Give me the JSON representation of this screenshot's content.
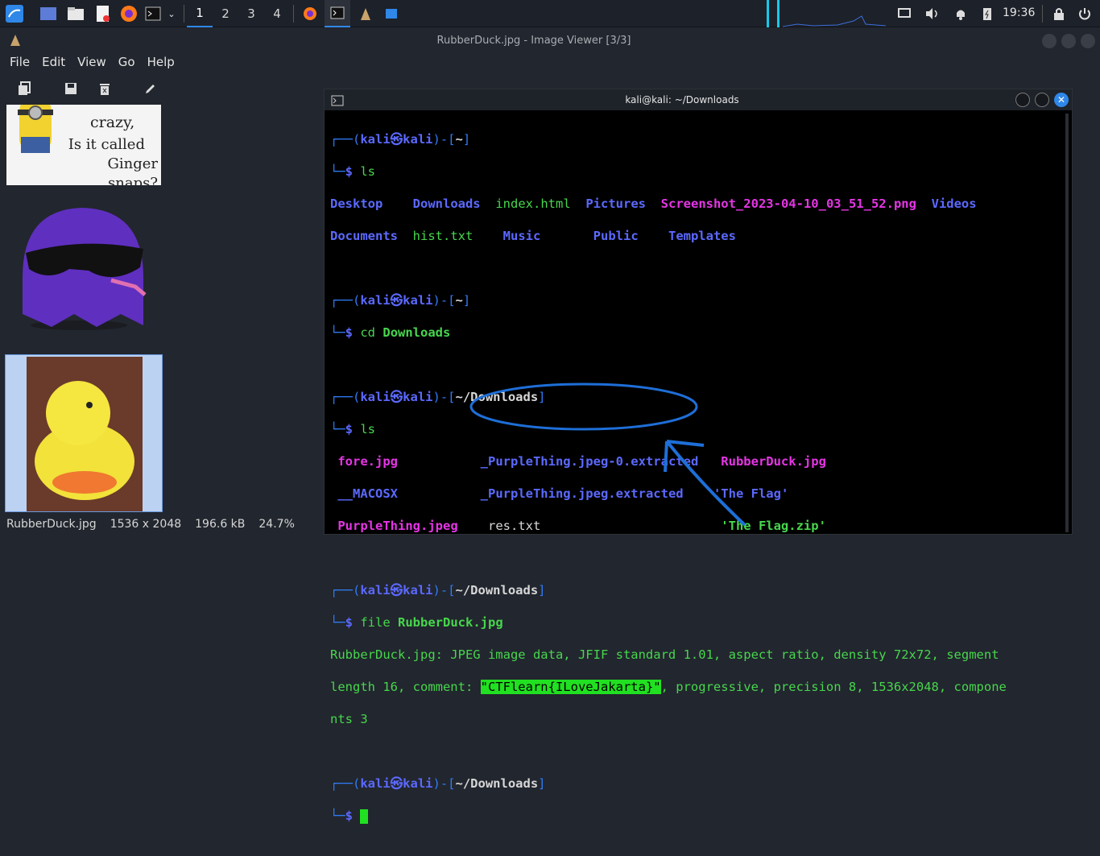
{
  "taskbar": {
    "workspaces": [
      "1",
      "2",
      "3",
      "4"
    ],
    "clock": "19:36"
  },
  "viewer": {
    "title": "RubberDuck.jpg - Image Viewer [3/3]",
    "menus": [
      "File",
      "Edit",
      "View",
      "Go",
      "Help"
    ],
    "thumb1_text": [
      "crazy,",
      "Is it called",
      "Ginger snaps?"
    ],
    "status": {
      "filename": "RubberDuck.jpg",
      "dimensions": "1536 x 2048",
      "size": "196.6 kB",
      "zoom": "24.7%"
    }
  },
  "terminal": {
    "title": "kali@kali: ~/Downloads",
    "prompt_user": "kali",
    "prompt_host": "kali",
    "cmd1": "ls",
    "cmd2": "cd",
    "cmd2_arg": "Downloads",
    "cmd3": "ls",
    "cmd4": "file",
    "cmd4_arg": "RubberDuck.jpg",
    "ls1": [
      "Desktop",
      "Downloads",
      "index.html",
      "Pictures",
      "Screenshot_2023-04-10_03_51_52.png",
      "Videos",
      "Documents",
      "hist.txt",
      "Music",
      "Public",
      "Templates"
    ],
    "ls2": [
      "fore.jpg",
      "_PurpleThing.jpeg-0.extracted",
      "RubberDuck.jpg",
      "__MACOSX",
      "_PurpleThing.jpeg.extracted",
      "'The Flag'",
      "PurpleThing.jpeg",
      "res.txt",
      "'The Flag.zip'"
    ],
    "file_out_1": "RubberDuck.jpg: JPEG image data, JFIF standard 1.01, aspect ratio, density 72x72, segment",
    "file_out_2a": "length 16, comment: ",
    "file_out_flag": "\"CTFlearn{ILoveJakarta}\"",
    "file_out_2b": ", progressive, precision 8, 1536x2048, compone",
    "file_out_3": "nts 3",
    "dir_home": "~",
    "dir_dl": "~/Downloads"
  }
}
